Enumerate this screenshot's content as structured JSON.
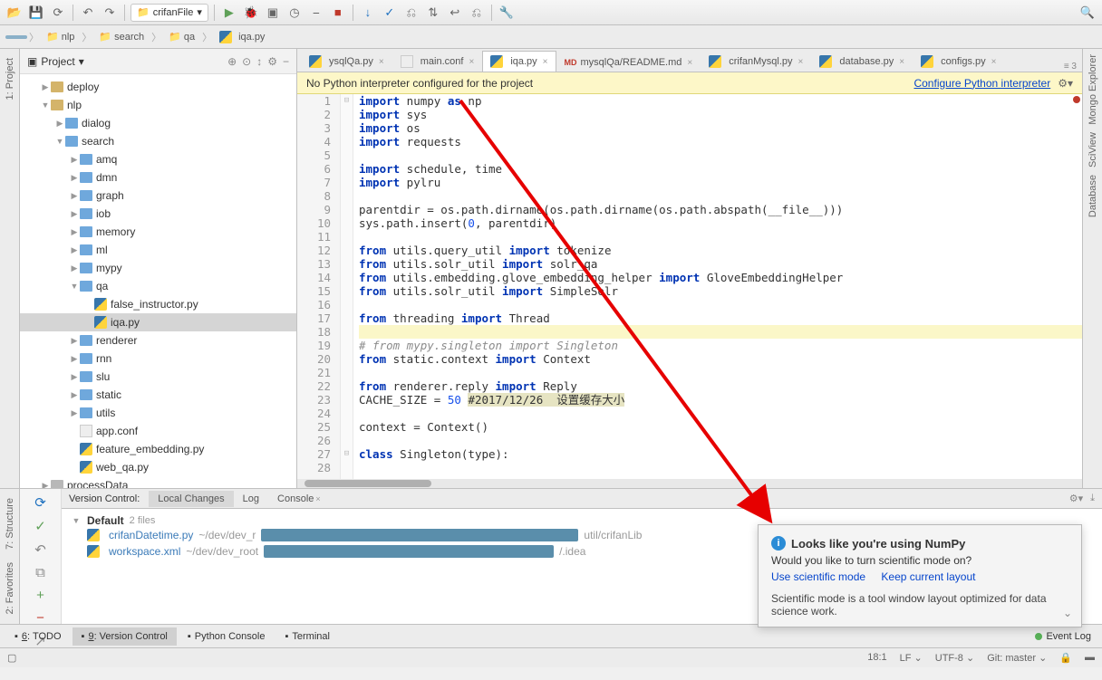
{
  "toolbar": {
    "run_config_icon": "folder",
    "run_config_label": "crifanFile"
  },
  "breadcrumb": {
    "items": [
      "",
      "nlp",
      "search",
      "qa",
      "iqa.py"
    ]
  },
  "project": {
    "title": "Project",
    "tree": [
      {
        "depth": 1,
        "arrow": "▶",
        "icon": "folder",
        "label": "deploy"
      },
      {
        "depth": 1,
        "arrow": "▼",
        "icon": "folder",
        "label": "nlp"
      },
      {
        "depth": 2,
        "arrow": "▶",
        "icon": "folder-blue",
        "label": "dialog"
      },
      {
        "depth": 2,
        "arrow": "▼",
        "icon": "folder-blue",
        "label": "search"
      },
      {
        "depth": 3,
        "arrow": "▶",
        "icon": "folder-blue",
        "label": "amq"
      },
      {
        "depth": 3,
        "arrow": "▶",
        "icon": "folder-blue",
        "label": "dmn"
      },
      {
        "depth": 3,
        "arrow": "▶",
        "icon": "folder-blue",
        "label": "graph"
      },
      {
        "depth": 3,
        "arrow": "▶",
        "icon": "folder-blue",
        "label": "iob"
      },
      {
        "depth": 3,
        "arrow": "▶",
        "icon": "folder-blue",
        "label": "memory"
      },
      {
        "depth": 3,
        "arrow": "▶",
        "icon": "folder-blue",
        "label": "ml"
      },
      {
        "depth": 3,
        "arrow": "▶",
        "icon": "folder-blue",
        "label": "mypy"
      },
      {
        "depth": 3,
        "arrow": "▼",
        "icon": "folder-blue",
        "label": "qa"
      },
      {
        "depth": 4,
        "arrow": "",
        "icon": "py",
        "label": "false_instructor.py"
      },
      {
        "depth": 4,
        "arrow": "",
        "icon": "py",
        "label": "iqa.py",
        "selected": true
      },
      {
        "depth": 3,
        "arrow": "▶",
        "icon": "folder-blue",
        "label": "renderer"
      },
      {
        "depth": 3,
        "arrow": "▶",
        "icon": "folder-blue",
        "label": "rnn"
      },
      {
        "depth": 3,
        "arrow": "▶",
        "icon": "folder-blue",
        "label": "slu"
      },
      {
        "depth": 3,
        "arrow": "▶",
        "icon": "folder-blue",
        "label": "static"
      },
      {
        "depth": 3,
        "arrow": "▶",
        "icon": "folder-blue",
        "label": "utils"
      },
      {
        "depth": 3,
        "arrow": "",
        "icon": "file",
        "label": "app.conf"
      },
      {
        "depth": 3,
        "arrow": "",
        "icon": "py",
        "label": "feature_embedding.py"
      },
      {
        "depth": 3,
        "arrow": "",
        "icon": "py",
        "label": "web_qa.py"
      },
      {
        "depth": 1,
        "arrow": "▶",
        "icon": "folder-gray",
        "label": "processData"
      }
    ]
  },
  "tabs": [
    {
      "label": "ysqlQa.py",
      "icon": "py"
    },
    {
      "label": "main.conf",
      "icon": "file"
    },
    {
      "label": "iqa.py",
      "icon": "py",
      "active": true
    },
    {
      "label": "mysqlQa/README.md",
      "icon": "md"
    },
    {
      "label": "crifanMysql.py",
      "icon": "py"
    },
    {
      "label": "database.py",
      "icon": "py"
    },
    {
      "label": "configs.py",
      "icon": "py"
    }
  ],
  "tabs_more": "≡ 3",
  "interp": {
    "msg": "No Python interpreter configured for the project",
    "link": "Configure Python interpreter"
  },
  "code": {
    "lines": [
      {
        "n": 1,
        "html": "<span class='kw'>import</span> numpy <span class='kw'>as</span> np"
      },
      {
        "n": 2,
        "html": "<span class='kw'>import</span> sys"
      },
      {
        "n": 3,
        "html": "<span class='kw'>import</span> os"
      },
      {
        "n": 4,
        "html": "<span class='kw'>import</span> requests"
      },
      {
        "n": 5,
        "html": ""
      },
      {
        "n": 6,
        "html": "<span class='kw'>import</span> schedule, time"
      },
      {
        "n": 7,
        "html": "<span class='kw'>import</span> pylru"
      },
      {
        "n": 8,
        "html": ""
      },
      {
        "n": 9,
        "html": "parentdir = os.path.dirname(os.path.dirname(os.path.abspath(__file__)))"
      },
      {
        "n": 10,
        "html": "sys.path.insert(<span class='num'>0</span>, parentdir)"
      },
      {
        "n": 11,
        "html": ""
      },
      {
        "n": 12,
        "html": "<span class='kw'>from</span> utils.query_util <span class='kw'>import</span> tokenize"
      },
      {
        "n": 13,
        "html": "<span class='kw'>from</span> utils.solr_util <span class='kw'>import</span> solr_qa"
      },
      {
        "n": 14,
        "html": "<span class='kw'>from</span> utils.embedding.glove_embedding_helper <span class='kw'>import</span> GloveEmbeddingHelper"
      },
      {
        "n": 15,
        "html": "<span class='kw'>from</span> utils.solr_util <span class='kw'>import</span> SimpleSolr"
      },
      {
        "n": 16,
        "html": ""
      },
      {
        "n": 17,
        "html": "<span class='kw'>from</span> threading <span class='kw'>import</span> Thread"
      },
      {
        "n": 18,
        "html": "",
        "hl": true
      },
      {
        "n": 19,
        "html": "<span class='com'># from mypy.singleton import Singleton</span>"
      },
      {
        "n": 20,
        "html": "<span class='kw'>from</span> static.context <span class='kw'>import</span> Context"
      },
      {
        "n": 21,
        "html": ""
      },
      {
        "n": 22,
        "html": "<span class='kw'>from</span> renderer.reply <span class='kw'>import</span> Reply"
      },
      {
        "n": 23,
        "html": "CACHE_SIZE = <span class='num'>50</span> <span class='hlspan'>#2017/12/26  设置缓存大小</span>"
      },
      {
        "n": 24,
        "html": ""
      },
      {
        "n": 25,
        "html": "context = Context()"
      },
      {
        "n": 26,
        "html": ""
      },
      {
        "n": 27,
        "html": "<span class='kw'>class</span> Singleton(type):"
      },
      {
        "n": 28,
        "html": ""
      }
    ]
  },
  "left_rail": {
    "label": "1: Project"
  },
  "right_rail": {
    "labels": [
      "Mongo Explorer",
      "SciView",
      "Database"
    ]
  },
  "left_rail2": {
    "labels": [
      "7: Structure",
      "2: Favorites"
    ]
  },
  "vc": {
    "title": "Version Control:",
    "tabs": [
      "Local Changes",
      "Log",
      "Console"
    ],
    "changelist": "Default",
    "files_count": "2 files",
    "items": [
      {
        "name": "crifanDatetime.py",
        "path_pre": "~/dev/dev_r",
        "path_post": "util/crifanLib",
        "redact_w": 350
      },
      {
        "name": "workspace.xml",
        "path_pre": "~/dev/dev_root",
        "path_post": "/.idea",
        "redact_w": 320
      }
    ]
  },
  "bottom_tabs": [
    {
      "label": "6: TODO",
      "underline": "6"
    },
    {
      "label": "9: Version Control",
      "underline": "9",
      "active": true
    },
    {
      "label": "Python Console"
    },
    {
      "label": "Terminal"
    }
  ],
  "event_log": "Event Log",
  "status": {
    "pos": "18:1",
    "line_sep": "LF",
    "encoding": "UTF-8",
    "git": "Git: master",
    "lock": "🔒"
  },
  "popup": {
    "title": "Looks like you're using NumPy",
    "sub": "Would you like to turn scientific mode on?",
    "link1": "Use scientific mode",
    "link2": "Keep current layout",
    "desc": "Scientific mode is a tool window layout optimized for data science work."
  }
}
